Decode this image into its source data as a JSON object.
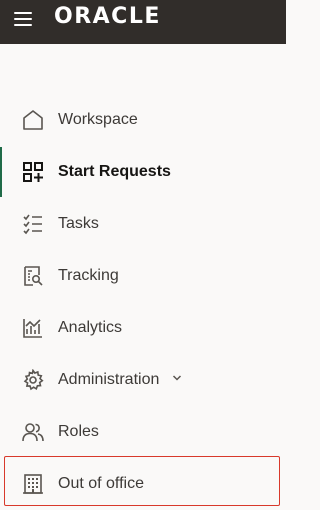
{
  "header": {
    "menu_icon": "hamburger-menu-icon",
    "logo_text": "ORACLE"
  },
  "nav": {
    "items": [
      {
        "label": "Workspace",
        "icon": "home-icon",
        "active": false
      },
      {
        "label": "Start Requests",
        "icon": "grid-plus-icon",
        "active": true
      },
      {
        "label": "Tasks",
        "icon": "checklist-icon",
        "active": false
      },
      {
        "label": "Tracking",
        "icon": "document-search-icon",
        "active": false
      },
      {
        "label": "Analytics",
        "icon": "bar-chart-icon",
        "active": false
      },
      {
        "label": "Administration",
        "icon": "gear-icon",
        "active": false,
        "has_dropdown": true
      },
      {
        "label": "Roles",
        "icon": "users-icon",
        "active": false
      },
      {
        "label": "Out of office",
        "icon": "building-icon",
        "active": false,
        "highlighted": true
      }
    ]
  },
  "colors": {
    "topbar": "#312d2a",
    "background": "#faf9f8",
    "active_indicator": "#1f6b48",
    "highlight_border": "#d8392b",
    "icon": "#5a5651",
    "text": "#3d3a37"
  }
}
